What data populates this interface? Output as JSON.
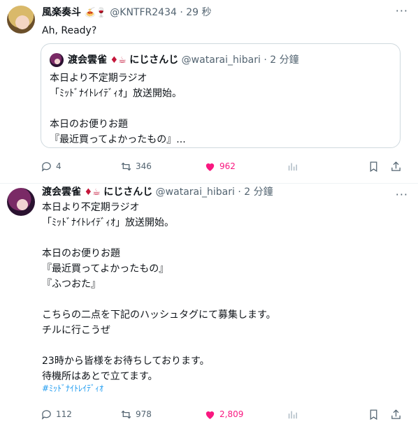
{
  "tweet1": {
    "display_name": "風楽奏斗",
    "name_emoji": "🍝🍷",
    "handle": "@KNTFR2434",
    "sep": "·",
    "time": "29 秒",
    "text": "Ah, Ready?",
    "quote": {
      "display_name": "渡会雲雀",
      "name_emoji": "♦☕",
      "name_suffix": "にじさんじ",
      "handle": "@watarai_hibari",
      "sep": "·",
      "time": "2 分鐘",
      "text": "本日より不定期ラジオ\n「ﾐｯﾄﾞﾅｲﾄﾚｲﾃﾞｨｵ」放送開始。\n\n本日のお便りお題\n『最近買ってよかったもの』..."
    },
    "actions": {
      "replies": "4",
      "retweets": "346",
      "likes": "962"
    }
  },
  "tweet2": {
    "display_name": "渡会雲雀",
    "name_emoji": "♦☕",
    "name_suffix": "にじさんじ",
    "handle": "@watarai_hibari",
    "sep": "·",
    "time": "2 分鐘",
    "text": "本日より不定期ラジオ\n「ﾐｯﾄﾞﾅｲﾄﾚｲﾃﾞｨｵ」放送開始。\n\n本日のお便りお題\n『最近買ってよかったもの』\n『ふつおた』\n\nこちらの二点を下記のハッシュタグにて募集します。\nチルに行こうぜ\n\n23時から皆様をお待ちしております。\n待機所はあとで立てます。",
    "hashtag": "#ﾐｯﾄﾞﾅｲﾄﾚｲﾃﾞｨｵ",
    "actions": {
      "replies": "112",
      "retweets": "978",
      "likes": "2,809"
    }
  },
  "icons": {
    "reply": "reply-icon",
    "retweet": "retweet-icon",
    "like": "heart-icon",
    "views": "views-icon",
    "bookmark": "bookmark-icon",
    "share": "share-icon",
    "more": "more-icon"
  },
  "colors": {
    "like": "#f91880",
    "link": "#1d9bf0",
    "muted": "#536471",
    "border": "#cfd9de"
  }
}
